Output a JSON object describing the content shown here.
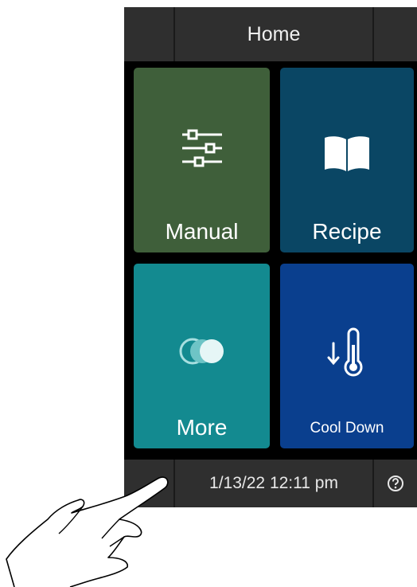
{
  "header": {
    "title": "Home"
  },
  "tiles": [
    {
      "label": "Manual",
      "icon": "sliders-icon",
      "color": "#3f5f3a"
    },
    {
      "label": "Recipe",
      "icon": "open-book-icon",
      "color": "#0a4664"
    },
    {
      "label": "More",
      "icon": "toggle-circles-icon",
      "color": "#138a90"
    },
    {
      "label": "Cool Down",
      "icon": "thermometer-down-icon",
      "color": "#0a3f8e"
    }
  ],
  "footer": {
    "datetime": "1/13/22 12:11 pm",
    "help_icon": "question-circle-icon"
  },
  "overlay": {
    "icon": "pointing-hand-icon"
  }
}
